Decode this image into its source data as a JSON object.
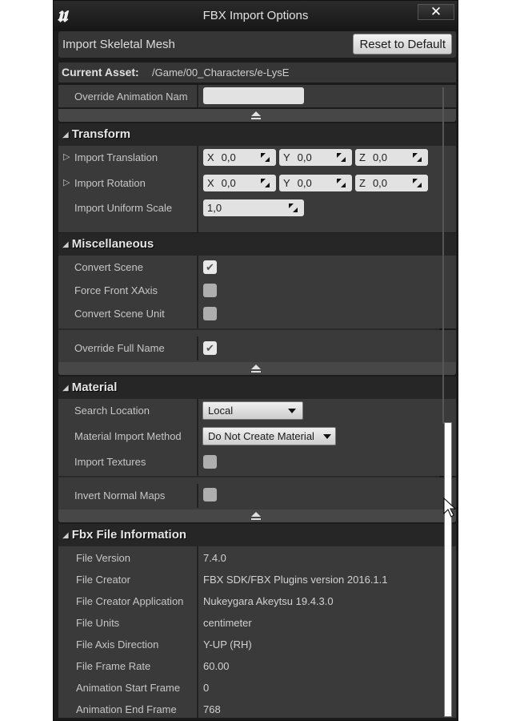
{
  "window": {
    "title": "FBX Import Options",
    "close_label": "✕",
    "logo_text": "u"
  },
  "header": {
    "import_type": "Import Skeletal Mesh",
    "reset_label": "Reset to Default"
  },
  "asset": {
    "label": "Current Asset:",
    "path": "/Game/00_Characters/e-LysE"
  },
  "animation": {
    "override_name_label": "Override Animation Nam",
    "override_name_value": ""
  },
  "transform": {
    "title": "Transform",
    "translation": {
      "label": "Import Translation",
      "x": "0,0",
      "y": "0,0",
      "z": "0,0"
    },
    "rotation": {
      "label": "Import Rotation",
      "x": "0,0",
      "y": "0,0",
      "z": "0,0"
    },
    "uniform_scale": {
      "label": "Import Uniform Scale",
      "value": "1,0"
    },
    "axis_labels": {
      "x": "X",
      "y": "Y",
      "z": "Z"
    }
  },
  "miscellaneous": {
    "title": "Miscellaneous",
    "items": [
      {
        "label": "Convert Scene",
        "checked": true
      },
      {
        "label": "Force Front XAxis",
        "checked": false
      },
      {
        "label": "Convert Scene Unit",
        "checked": false
      }
    ],
    "advanced": [
      {
        "label": "Override Full Name",
        "checked": true
      }
    ]
  },
  "material": {
    "title": "Material",
    "search_location": {
      "label": "Search Location",
      "value": "Local"
    },
    "import_method": {
      "label": "Material Import Method",
      "value": "Do Not Create Material"
    },
    "import_textures": {
      "label": "Import Textures",
      "checked": false
    },
    "invert_normal_maps": {
      "label": "Invert Normal Maps",
      "checked": false
    }
  },
  "fbx_info": {
    "title": "Fbx File Information",
    "rows": [
      {
        "label": "File Version",
        "value": "7.4.0"
      },
      {
        "label": "File Creator",
        "value": "FBX SDK/FBX Plugins version 2016.1.1"
      },
      {
        "label": "File Creator Application",
        "value": "Nukeygara Akeytsu 19.4.3.0"
      },
      {
        "label": "File Units",
        "value": "centimeter"
      },
      {
        "label": "File Axis Direction",
        "value": "Y-UP (RH)"
      },
      {
        "label": "File Frame Rate",
        "value": "60.00"
      },
      {
        "label": "Animation Start Frame",
        "value": "0"
      },
      {
        "label": "Animation End Frame",
        "value": "768"
      }
    ]
  },
  "glyphs": {
    "check": "✔",
    "collapse": "◢",
    "expand": "▷"
  }
}
